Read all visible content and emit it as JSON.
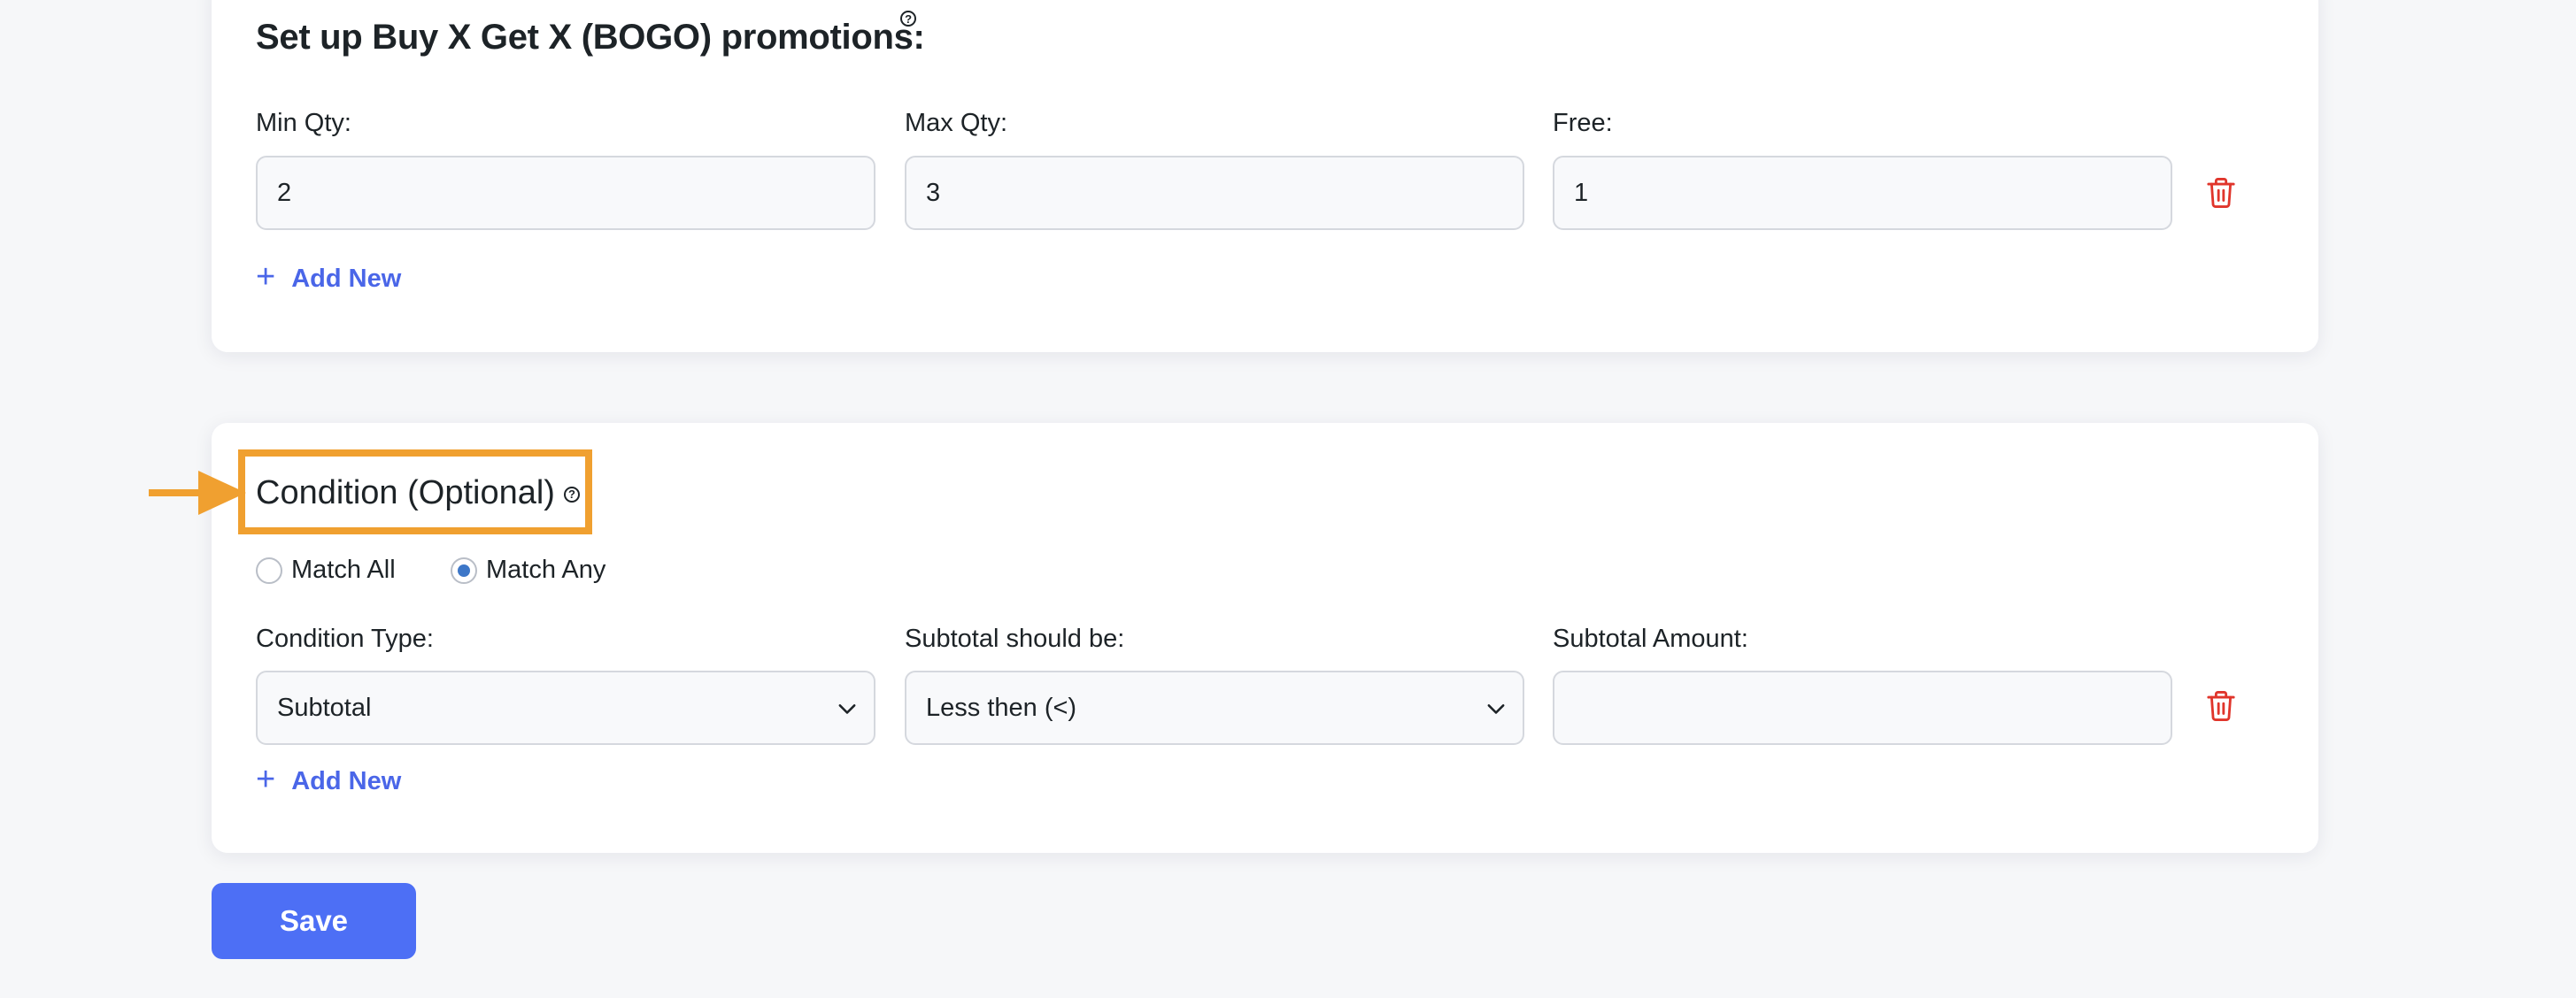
{
  "bogo": {
    "title": "Set up Buy X Get X (BOGO) promotions:",
    "help_glyph": "?",
    "fields": [
      {
        "label": "Min Qty:",
        "value": "2"
      },
      {
        "label": "Max Qty:",
        "value": "3"
      },
      {
        "label": "Free:",
        "value": "1"
      }
    ],
    "add_new_label": "Add New"
  },
  "condition": {
    "title": "Condition (Optional)",
    "help_glyph": "?",
    "radios": [
      {
        "label": "Match All",
        "checked": false
      },
      {
        "label": "Match Any",
        "checked": true
      }
    ],
    "fields": [
      {
        "label": "Condition Type:",
        "value": "Subtotal"
      },
      {
        "label": "Subtotal should be:",
        "value": "Less then (<)"
      },
      {
        "label": "Subtotal Amount:",
        "value": ""
      }
    ],
    "add_new_label": "Add New"
  },
  "save_label": "Save",
  "colors": {
    "accent": "#4d6ff5",
    "link": "#4a66e8",
    "danger": "#e0352b",
    "highlight": "#f0a030",
    "radio_checked": "#3d77c8"
  },
  "icons": {
    "delete": "trash-icon",
    "add": "plus-icon",
    "help": "help-icon",
    "select": "chevron-down-icon",
    "pointer": "arrow-right-icon"
  }
}
